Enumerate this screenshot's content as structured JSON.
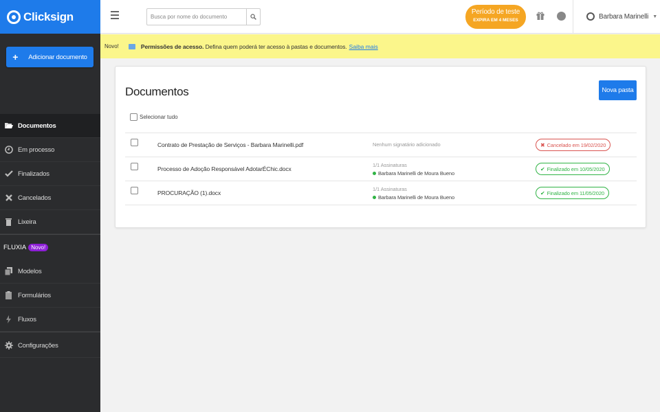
{
  "brand": {
    "name": "Clicksign"
  },
  "sidebar": {
    "add_label": "Adicionar documento",
    "items": [
      {
        "label": "Documentos",
        "icon": "folder-open-icon"
      },
      {
        "label": "Em processo",
        "icon": "clock-icon"
      },
      {
        "label": "Finalizados",
        "icon": "check-icon"
      },
      {
        "label": "Cancelados",
        "icon": "x-icon"
      },
      {
        "label": "Lixeira",
        "icon": "trash-icon"
      }
    ],
    "section_label": "FLUXIA",
    "section_badge": "Novo!",
    "fluxia_items": [
      {
        "label": "Modelos",
        "icon": "copy-icon"
      },
      {
        "label": "Formulários",
        "icon": "clipboard-icon"
      },
      {
        "label": "Fluxos",
        "icon": "bolt-icon"
      }
    ],
    "settings_label": "Configurações"
  },
  "header": {
    "search_placeholder": "Busca por nome do documento",
    "trial_title": "Período de teste",
    "trial_sub": "EXPIRA EM 4 MESES",
    "user_name": "Barbara Marinelli"
  },
  "notice": {
    "badge": "Novo!",
    "bold": "Permissões de acesso.",
    "text": "Defina quem poderá ter acesso à pastas e documentos.",
    "link": "Saiba mais"
  },
  "main": {
    "title": "Documentos",
    "new_folder": "Nova pasta",
    "select_all": "Selecionar tudo",
    "rows": [
      {
        "name": "Contrato de Prestação de Serviços - Barbara Marinelli.pdf",
        "sig_title": "",
        "sig_none": "Nenhum signatário adicionado",
        "signer": "",
        "status": "Cancelado em 19/02/2020"
      },
      {
        "name": "Processo de Adoção Responsável AdotarÉChic.docx",
        "sig_title": "1/1 Assinaturas",
        "sig_none": "",
        "signer": "Barbara Marinelli de Moura Bueno",
        "status": "Finalizado em 10/05/2020"
      },
      {
        "name": "PROCURAÇÃO (1).docx",
        "sig_title": "1/1 Assinaturas",
        "sig_none": "",
        "signer": "Barbara Marinelli de Moura Bueno",
        "status": "Finalizado em 11/05/2020"
      }
    ]
  },
  "colors": {
    "brand": "#1e7bea",
    "sidebar": "#2b2c2e",
    "trial": "#f5a623",
    "notice": "#fbf68b",
    "success": "#2fb344",
    "danger": "#d9534f",
    "novo": "#8d1fd6"
  }
}
